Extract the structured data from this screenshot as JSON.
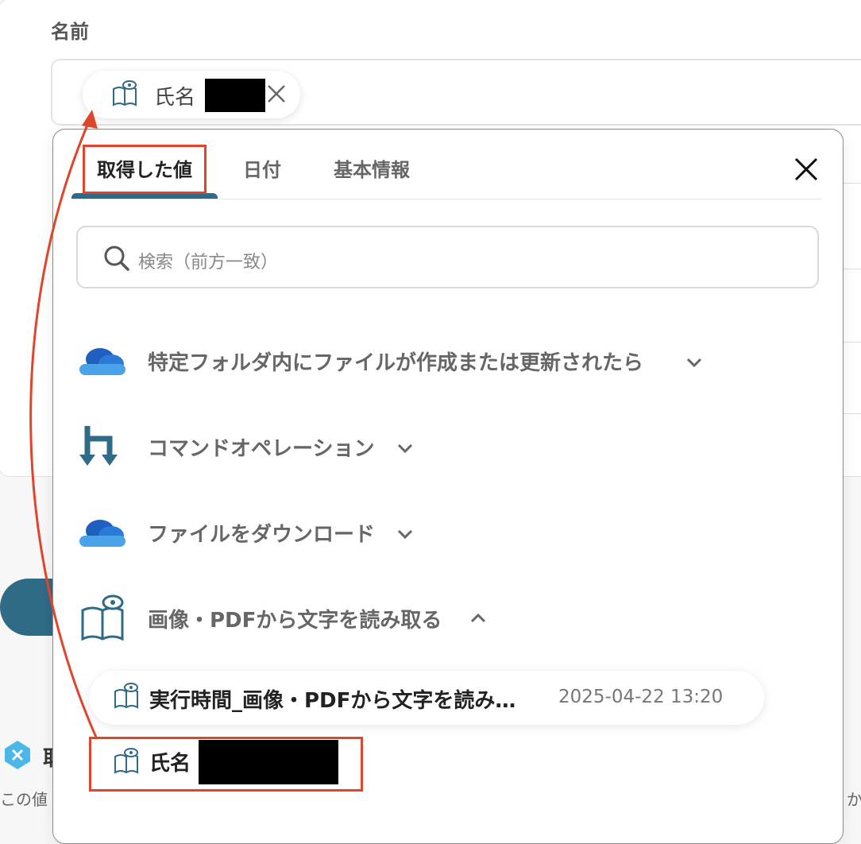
{
  "form": {
    "field_label": "名前",
    "token": {
      "label": "氏名",
      "icon": "book-eye-icon",
      "remove_icon": "close-icon"
    },
    "badge_text": "取",
    "bottom_text_left": "この値",
    "bottom_text_right": "か"
  },
  "panel": {
    "tabs": [
      {
        "label": "取得した値",
        "active": true
      },
      {
        "label": "日付",
        "active": false
      },
      {
        "label": "基本情報",
        "active": false
      }
    ],
    "close_icon": "close-icon",
    "search": {
      "placeholder": "検索（前方一致）",
      "icon": "search-icon"
    },
    "sections": [
      {
        "label": "特定フォルダ内にファイルが作成または更新されたら",
        "icon": "onedrive-cloud-icon",
        "expanded": false
      },
      {
        "label": "コマンドオペレーション",
        "icon": "command-operation-icon",
        "expanded": false
      },
      {
        "label": "ファイルをダウンロード",
        "icon": "onedrive-cloud-icon",
        "expanded": false
      },
      {
        "label": "画像・PDFから文字を読み取る",
        "icon": "book-eye-icon",
        "expanded": true
      }
    ],
    "items": [
      {
        "label": "実行時間_画像・PDFから文字を読み…",
        "time": "2025-04-22 13:20"
      },
      {
        "label": "氏名",
        "time": ""
      }
    ]
  },
  "colors": {
    "accent": "#2f6a87",
    "highlight": "#e0452b",
    "onedrive_dark": "#1e5fbf",
    "onedrive_light": "#4aa3e8"
  }
}
